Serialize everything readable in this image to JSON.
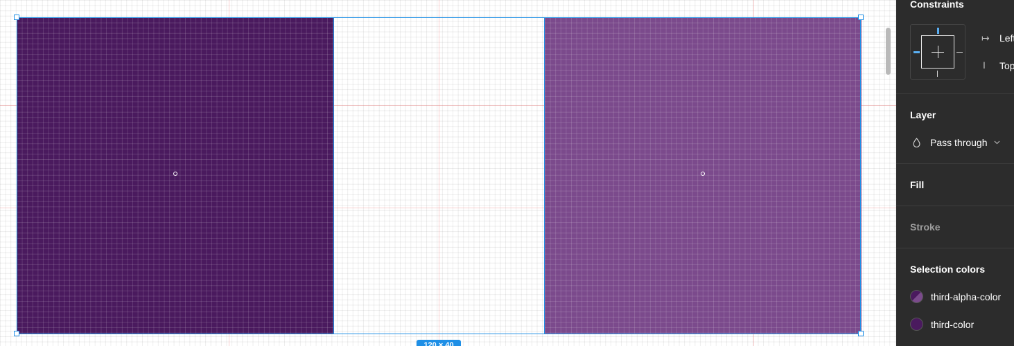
{
  "canvas": {
    "selection_size": "120 × 40",
    "colors": {
      "third_color": "#4a1a5e",
      "third_alpha_color": "#7b4a8c",
      "selection": "#1e8fe6"
    }
  },
  "panel": {
    "constraints": {
      "title": "Constraints",
      "horizontal_label": "Left",
      "vertical_label": "Top"
    },
    "layer": {
      "title": "Layer",
      "blend_mode": "Pass through",
      "blend_icon": "drop-icon"
    },
    "fill": {
      "title": "Fill"
    },
    "stroke": {
      "title": "Stroke"
    },
    "selection_colors": {
      "title": "Selection colors",
      "items": [
        {
          "name": "third-alpha-color",
          "color": "#7b4a8c"
        },
        {
          "name": "third-color",
          "color": "#4a1a5e"
        }
      ]
    }
  }
}
